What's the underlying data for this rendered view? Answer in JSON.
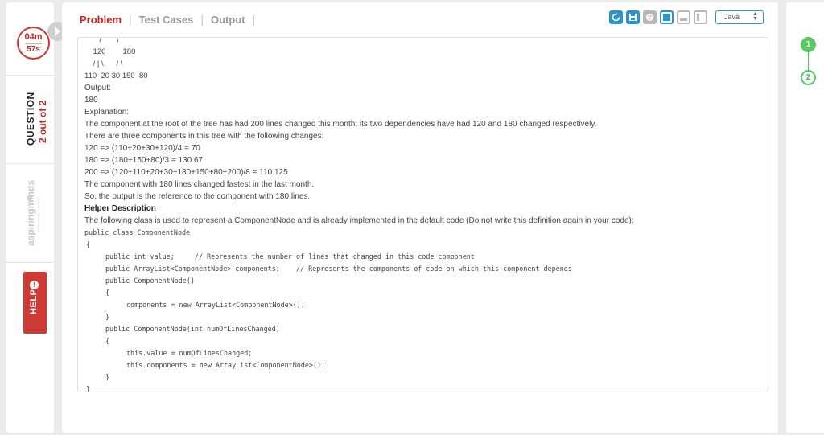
{
  "timer": {
    "minutes": "04m",
    "seconds": "57s"
  },
  "question": {
    "label": "QUESTION",
    "count": "2 out of 2"
  },
  "brand": {
    "name": "aspiringminds",
    "tagline": "Employability Quantified"
  },
  "help": {
    "label": "HELP",
    "icon": "!"
  },
  "tabs": [
    {
      "label": "Problem"
    },
    {
      "label": "Test Cases"
    },
    {
      "label": "Output"
    }
  ],
  "tab_separator": "|",
  "toolbar": {
    "icons": [
      "reset-icon",
      "save-icon",
      "palette-icon",
      "layout-full-icon",
      "layout-bottom-icon",
      "layout-left-icon"
    ],
    "language": "Java",
    "language_arrow": "▲▼"
  },
  "problem": {
    "tree_top": "       /       \\",
    "tree_level1": "    120        180",
    "tree_level2": "    / | \\      / \\",
    "tree_level3": "110  20 30 150  80",
    "output_label": "Output:",
    "output_value": "180",
    "explanation_label": "Explanation:",
    "explanation_lines": [
      "The component at the root of the tree has had 200 lines changed this month; its two dependencies have had 120 and 180 changed respectively.",
      "There are three components in this tree with the following changes:",
      "120 => (110+20+30+120)/4 = 70",
      "180 => (180+150+80)/3 = 130.67",
      "200 => (120+110+20+30+180+150+80+200)/8 = 110.125",
      "The component with 180 lines changed fastest in the last month.",
      "So, the output is the reference to the component with 180 lines."
    ],
    "helper_title": "Helper Description",
    "helper_text": "The following class is used to represent a ComponentNode and is already implemented in the default code (Do not write this definition again in your code):",
    "code": {
      "class_decl": "public class ComponentNode",
      "open_brace": "{",
      "field_value": "public int value;     // Represents the number of lines that changed in this code component",
      "field_components": "public ArrayList<ComponentNode> components;    // Represents the components of code on which this component depends",
      "ctor1": "public ComponentNode()",
      "ctor1_open": "{",
      "ctor1_body": "components = new ArrayList<ComponentNode>();",
      "ctor1_close": "}",
      "ctor2": "public ComponentNode(int numOfLinesChanged)",
      "ctor2_open": "{",
      "ctor2_body1": "this.value = numOfLinesChanged;",
      "ctor2_body2": "this.components = new ArrayList<ComponentNode>();",
      "ctor2_close": "}",
      "close_brace": "}"
    }
  },
  "steps": [
    {
      "label": "1",
      "state": "completed"
    },
    {
      "label": "2",
      "state": "current"
    }
  ],
  "colors": {
    "accent_red": "#c62828",
    "accent_blue": "#2a93c9",
    "step_green": "#59c965"
  }
}
